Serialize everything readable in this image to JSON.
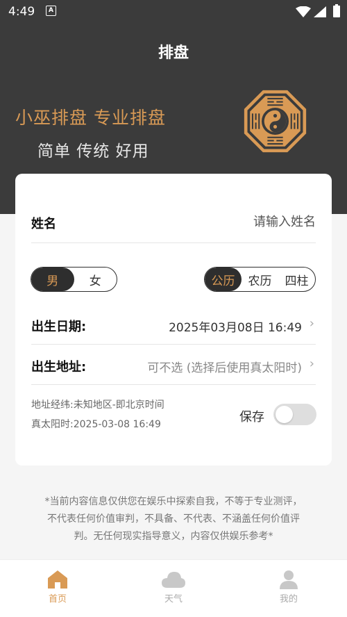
{
  "status": {
    "time": "4:49",
    "notif_glyph": "A"
  },
  "header": {
    "title": "排盘"
  },
  "hero": {
    "line1": "小巫排盘 专业排盘",
    "line2": "简单 传统 好用",
    "emblem_icon": "bagua-taiji-icon"
  },
  "form": {
    "name_label": "姓名",
    "name_placeholder": "请输入姓名",
    "gender": {
      "options": [
        "男",
        "女"
      ],
      "selected": "男"
    },
    "calendar": {
      "options": [
        "公历",
        "农历",
        "四柱"
      ],
      "selected": "公历"
    },
    "birth_date_label": "出生日期:",
    "birth_date_value": "2025年03月08日 16:49",
    "birth_place_label": "出生地址:",
    "birth_place_value": "可不选 (选择后使用真太阳时)",
    "location_info": "地址经纬:未知地区-即北京时间",
    "solar_time_info": "真太阳时:2025-03-08 16:49",
    "save_label": "保存",
    "save_enabled": false
  },
  "disclaimer": {
    "line1": "*当前内容信息仅供您在娱乐中探索自我，不等于专业测评，",
    "line2": "不代表任何价值审判，不具备、不代表、不涵盖任何价值评",
    "line3": "判。无任何现实指导意义，内容仅供娱乐参考*"
  },
  "tabs": [
    {
      "label": "首页",
      "icon": "home-icon",
      "active": true
    },
    {
      "label": "天气",
      "icon": "cloud-icon",
      "active": false
    },
    {
      "label": "我的",
      "icon": "person-icon",
      "active": false
    }
  ],
  "colors": {
    "accent": "#d99a55",
    "dark": "#3b3b3b"
  }
}
